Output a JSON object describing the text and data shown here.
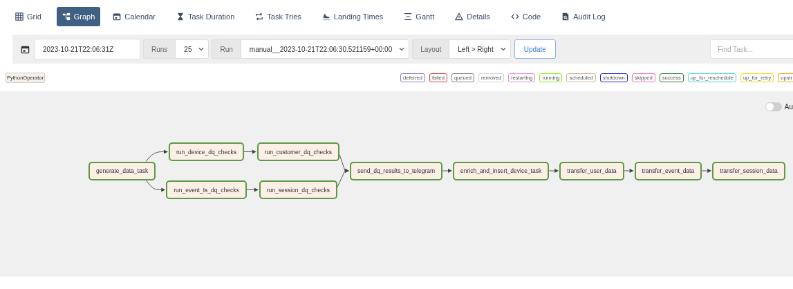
{
  "tabs": [
    {
      "label": "Grid",
      "selected": false
    },
    {
      "label": "Graph",
      "selected": true
    },
    {
      "label": "Calendar",
      "selected": false
    },
    {
      "label": "Task Duration",
      "selected": false
    },
    {
      "label": "Task Tries",
      "selected": false
    },
    {
      "label": "Landing Times",
      "selected": false
    },
    {
      "label": "Gantt",
      "selected": false
    },
    {
      "label": "Details",
      "selected": false
    },
    {
      "label": "Code",
      "selected": false
    },
    {
      "label": "Audit Log",
      "selected": false
    }
  ],
  "toolbar": {
    "date": "2023-10-21T22:06:31Z",
    "runs_label": "Runs",
    "runs_value": "25",
    "run_label": "Run",
    "run_value": "manual__2023-10-21T22:06:30.521159+00:00",
    "layout_label": "Layout",
    "layout_value": "Left > Right",
    "update_button": "Update",
    "find_placeholder": "Find Task..."
  },
  "operator_tag": "PythonOperator",
  "legend": [
    {
      "label": "deferred",
      "color": "#9370db"
    },
    {
      "label": "failed",
      "color": "#e53935"
    },
    {
      "label": "queued",
      "color": "#808080"
    },
    {
      "label": "removed",
      "color": "#d3d3d3"
    },
    {
      "label": "restarting",
      "color": "#ee82ee"
    },
    {
      "label": "running",
      "color": "#7cfc00"
    },
    {
      "label": "scheduled",
      "color": "#d2b48c"
    },
    {
      "label": "shutdown",
      "color": "#2020c8"
    },
    {
      "label": "skipped",
      "color": "#ff69b4"
    },
    {
      "label": "success",
      "color": "#2e7d32"
    },
    {
      "label": "up_for_reschedule",
      "color": "#40e0d0"
    },
    {
      "label": "up_for_retry",
      "color": "#ffd700"
    },
    {
      "label": "upstr",
      "color": "#ffa500"
    }
  ],
  "auto_refresh": {
    "label": "Au",
    "on": false
  },
  "graph": {
    "columns": [
      [
        {
          "label": "generate_data_task"
        }
      ],
      [
        {
          "label": "run_device_dq_checks"
        },
        {
          "label": "run_event_ts_dq_checks"
        }
      ],
      [
        {
          "label": "run_customer_dq_checks"
        },
        {
          "label": "run_session_dq_checks"
        }
      ],
      [
        {
          "label": "send_dq_results_to_telegram"
        }
      ],
      [
        {
          "label": "enrich_and_insert_device_task"
        }
      ],
      [
        {
          "label": "transfer_user_data"
        }
      ],
      [
        {
          "label": "transfer_event_data"
        }
      ],
      [
        {
          "label": "transfer_session_data"
        }
      ]
    ]
  }
}
